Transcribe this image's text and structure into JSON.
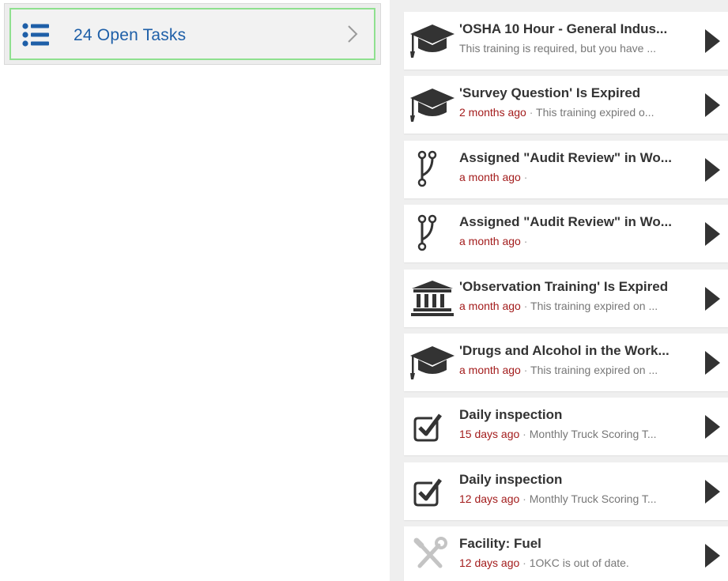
{
  "open_tasks": {
    "label": "24 Open Tasks",
    "icon": "list-icon",
    "accent_color": "#1e5fa8",
    "focus_border_color": "#8fe08f"
  },
  "tasks": [
    {
      "icon": "graduation-cap-icon",
      "title": "'OSHA 10 Hour - General Indus...",
      "time": "",
      "separator": "",
      "detail": "This training is required, but you have ..."
    },
    {
      "icon": "graduation-cap-icon",
      "title": "'Survey Question' Is Expired",
      "time": "2 months ago",
      "separator": " · ",
      "detail": "This training expired o..."
    },
    {
      "icon": "workflow-branch-icon",
      "title": "Assigned \"Audit Review\" in Wo...",
      "time": "a month ago",
      "separator": " · ",
      "detail": ""
    },
    {
      "icon": "workflow-branch-icon",
      "title": "Assigned \"Audit Review\" in Wo...",
      "time": "a month ago",
      "separator": " · ",
      "detail": ""
    },
    {
      "icon": "institution-icon",
      "title": "'Observation Training' Is Expired",
      "time": "a month ago",
      "separator": " · ",
      "detail": "This training expired on ..."
    },
    {
      "icon": "graduation-cap-icon",
      "title": "'Drugs and Alcohol in the Work...",
      "time": "a month ago",
      "separator": " · ",
      "detail": "This training expired on ..."
    },
    {
      "icon": "checkbox-icon",
      "title": "Daily inspection",
      "time": "15 days ago",
      "separator": " · ",
      "detail": "Monthly Truck Scoring T..."
    },
    {
      "icon": "checkbox-icon",
      "title": "Daily inspection",
      "time": "12 days ago",
      "separator": " · ",
      "detail": "Monthly Truck Scoring T..."
    },
    {
      "icon": "wrench-screwdriver-icon",
      "title": "Facility: Fuel",
      "time": "12 days ago",
      "separator": " · ",
      "detail": "1OKC is out of date."
    }
  ]
}
